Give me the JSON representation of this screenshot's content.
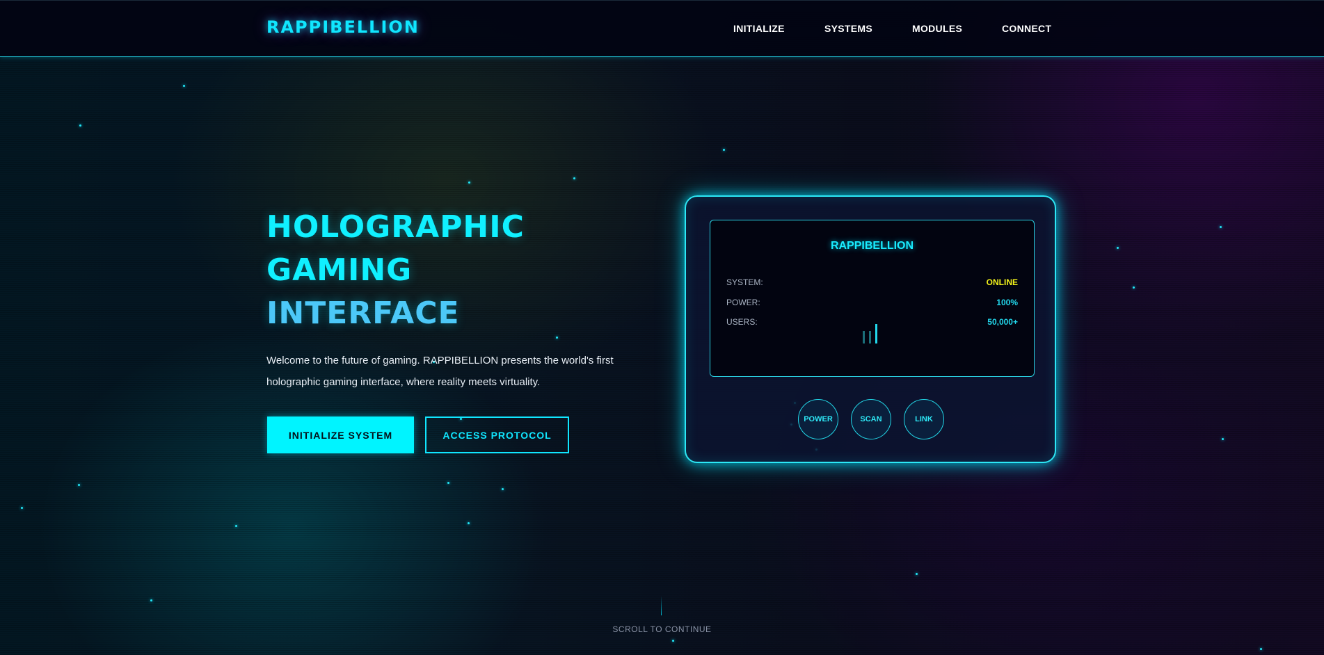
{
  "brand": {
    "logo": "RAPPIBELLION"
  },
  "nav": {
    "items": [
      {
        "label": "INITIALIZE"
      },
      {
        "label": "SYSTEMS"
      },
      {
        "label": "MODULES"
      },
      {
        "label": "CONNECT"
      }
    ]
  },
  "hero": {
    "title_line1": "HOLOGRAPHIC",
    "title_line2": "GAMING",
    "title_line3": "INTERFACE",
    "description": "Welcome to the future of gaming. RAPPIBELLION presents the world's first holographic gaming interface, where reality meets virtuality.",
    "primary_button": "INITIALIZE SYSTEM",
    "secondary_button": "ACCESS PROTOCOL"
  },
  "device": {
    "screen_title": "RAPPIBELLION",
    "stats": [
      {
        "label": "SYSTEM:",
        "value": "ONLINE",
        "color": "#f2f21a"
      },
      {
        "label": "POWER:",
        "value": "100%",
        "color": "#22d8ec"
      },
      {
        "label": "USERS:",
        "value": "50,000+",
        "color": "#22d8ec"
      }
    ],
    "controls": [
      {
        "label": "POWER"
      },
      {
        "label": "SCAN"
      },
      {
        "label": "LINK"
      }
    ]
  },
  "footer": {
    "scroll_hint": "SCROLL TO CONTINUE"
  },
  "colors": {
    "accent_cyan": "#00f4ff",
    "accent_blue": "#4cc8f8",
    "status_yellow": "#f2f21a",
    "background": "#05081a"
  }
}
